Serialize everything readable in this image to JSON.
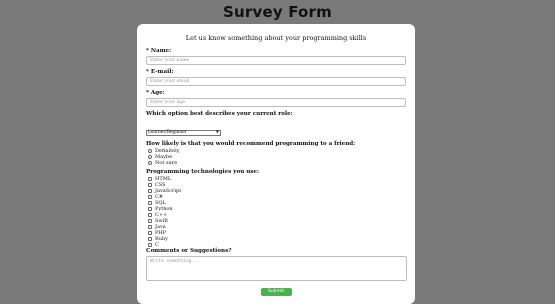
{
  "title": "Survey Form",
  "subtitle": "Let us know something about your programming skills",
  "fields": {
    "name": {
      "label": "* Name:",
      "placeholder": "Enter your name"
    },
    "email": {
      "label": "* E-mail:",
      "placeholder": "Enter your email"
    },
    "age": {
      "label": "* Age:",
      "placeholder": "Enter your age"
    }
  },
  "role": {
    "label": "Which option best describes your current role:",
    "selected": "Learner/Beginner"
  },
  "recommend": {
    "label": "How likely is that you would recommend programming to a friend:",
    "options": [
      "Definitely",
      "Maybe",
      "Not sure"
    ]
  },
  "technologies": {
    "label": "Programming technologies you use:",
    "options": [
      "HTML",
      "CSS",
      "JavaScript",
      "C#",
      "SQL",
      "Python",
      "C++",
      "Swift",
      "Java",
      "PHP",
      "Ruby",
      "C"
    ]
  },
  "comments": {
    "label": "Comments or Suggestions?",
    "placeholder": "Write something..."
  },
  "submit_label": "Submit",
  "colors": {
    "background": "#7a7a7a",
    "card": "#ffffff",
    "submit": "#4caf50"
  }
}
